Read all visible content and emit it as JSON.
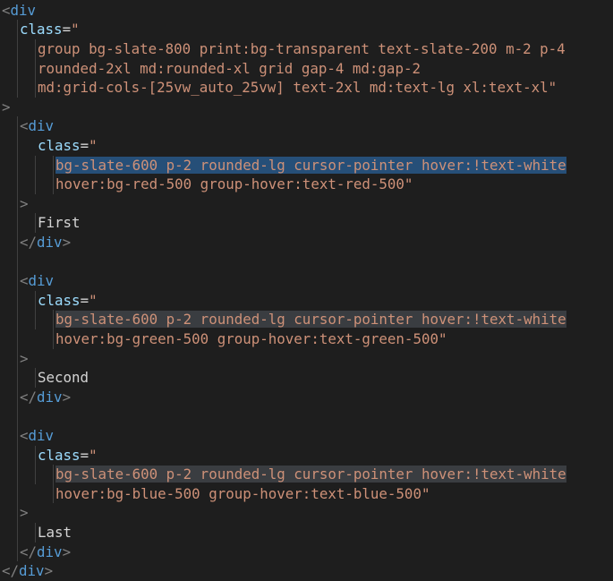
{
  "editor": {
    "lines": [
      {
        "indent": 0,
        "segments": [
          {
            "t": "<",
            "c": "punct"
          },
          {
            "t": "div",
            "c": "tag"
          }
        ]
      },
      {
        "indent": 1,
        "segments": [
          {
            "t": "class",
            "c": "attr"
          },
          {
            "t": "=",
            "c": "txt"
          },
          {
            "t": "\"",
            "c": "str"
          }
        ]
      },
      {
        "indent": 2,
        "segments": [
          {
            "t": "group bg-slate-800 print:bg-transparent text-slate-200 m-2 p-4",
            "c": "str"
          }
        ]
      },
      {
        "indent": 2,
        "segments": [
          {
            "t": "rounded-2xl md:rounded-xl grid gap-4 md:gap-2",
            "c": "str"
          }
        ]
      },
      {
        "indent": 2,
        "segments": [
          {
            "t": "md:grid-cols-[25vw_auto_25vw] text-2xl md:text-lg xl:text-xl\"",
            "c": "str"
          }
        ]
      },
      {
        "indent": 0,
        "segments": [
          {
            "t": ">",
            "c": "punct"
          }
        ]
      },
      {
        "indent": 1,
        "segments": [
          {
            "t": "<",
            "c": "punct"
          },
          {
            "t": "div",
            "c": "tag"
          }
        ]
      },
      {
        "indent": 2,
        "segments": [
          {
            "t": "class",
            "c": "attr"
          },
          {
            "t": "=",
            "c": "txt"
          },
          {
            "t": "\"",
            "c": "str"
          }
        ]
      },
      {
        "indent": 3,
        "segments": [
          {
            "t": "bg-slate-600 p-2 rounded-lg cursor-pointer hover:!text-white",
            "c": "str",
            "hl": "sel"
          }
        ]
      },
      {
        "indent": 3,
        "segments": [
          {
            "t": "hover:bg-red-500 group-hover:text-red-500\"",
            "c": "str"
          }
        ]
      },
      {
        "indent": 1,
        "segments": [
          {
            "t": ">",
            "c": "punct"
          }
        ]
      },
      {
        "indent": 2,
        "segments": [
          {
            "t": "First",
            "c": "txt"
          }
        ]
      },
      {
        "indent": 1,
        "segments": [
          {
            "t": "</",
            "c": "punct"
          },
          {
            "t": "div",
            "c": "tag"
          },
          {
            "t": ">",
            "c": "punct"
          }
        ]
      },
      {
        "indent": 0,
        "segments": []
      },
      {
        "indent": 1,
        "segments": [
          {
            "t": "<",
            "c": "punct"
          },
          {
            "t": "div",
            "c": "tag"
          }
        ]
      },
      {
        "indent": 2,
        "segments": [
          {
            "t": "class",
            "c": "attr"
          },
          {
            "t": "=",
            "c": "txt"
          },
          {
            "t": "\"",
            "c": "str"
          }
        ]
      },
      {
        "indent": 3,
        "segments": [
          {
            "t": "bg-slate-600 p-2 rounded-lg cursor-pointer hover:!text-white",
            "c": "str",
            "hl": "match"
          }
        ]
      },
      {
        "indent": 3,
        "segments": [
          {
            "t": "hover:bg-green-500 group-hover:text-green-500\"",
            "c": "str"
          }
        ]
      },
      {
        "indent": 1,
        "segments": [
          {
            "t": ">",
            "c": "punct"
          }
        ]
      },
      {
        "indent": 2,
        "segments": [
          {
            "t": "Second",
            "c": "txt"
          }
        ]
      },
      {
        "indent": 1,
        "segments": [
          {
            "t": "</",
            "c": "punct"
          },
          {
            "t": "div",
            "c": "tag"
          },
          {
            "t": ">",
            "c": "punct"
          }
        ]
      },
      {
        "indent": 0,
        "segments": []
      },
      {
        "indent": 1,
        "segments": [
          {
            "t": "<",
            "c": "punct"
          },
          {
            "t": "div",
            "c": "tag"
          }
        ]
      },
      {
        "indent": 2,
        "segments": [
          {
            "t": "class",
            "c": "attr"
          },
          {
            "t": "=",
            "c": "txt"
          },
          {
            "t": "\"",
            "c": "str"
          }
        ]
      },
      {
        "indent": 3,
        "segments": [
          {
            "t": "bg-slate-600 p-2 rounded-lg cursor-pointer hover:!text-white",
            "c": "str",
            "hl": "match"
          }
        ]
      },
      {
        "indent": 3,
        "segments": [
          {
            "t": "hover:bg-blue-500 group-hover:text-blue-500\"",
            "c": "str"
          }
        ]
      },
      {
        "indent": 1,
        "segments": [
          {
            "t": ">",
            "c": "punct"
          }
        ]
      },
      {
        "indent": 2,
        "segments": [
          {
            "t": "Last",
            "c": "txt"
          }
        ]
      },
      {
        "indent": 1,
        "segments": [
          {
            "t": "</",
            "c": "punct"
          },
          {
            "t": "div",
            "c": "tag"
          },
          {
            "t": ">",
            "c": "punct"
          }
        ]
      },
      {
        "indent": 0,
        "segments": [
          {
            "t": "</",
            "c": "punct"
          },
          {
            "t": "div",
            "c": "tag"
          },
          {
            "t": ">",
            "c": "punct"
          }
        ]
      }
    ]
  }
}
